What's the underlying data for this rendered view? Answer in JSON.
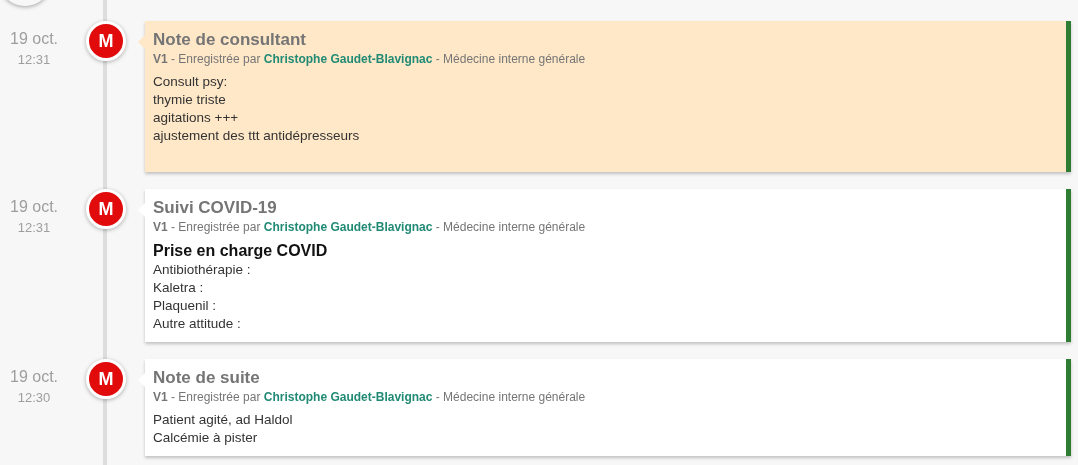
{
  "timeline": [
    {
      "date": "19 oct.",
      "time": "12:31",
      "marker": "M",
      "highlighted": true,
      "title": "Note de consultant",
      "version": "V1",
      "recorded_by": "- Enregistrée par",
      "author": "Christophe Gaudet-Blavignac",
      "service": "- Médecine interne générale",
      "body": [
        {
          "kind": "text",
          "text": "Consult psy:"
        },
        {
          "kind": "text",
          "text": "thymie triste"
        },
        {
          "kind": "text",
          "text": "agitations +++"
        },
        {
          "kind": "text",
          "text": "ajustement des ttt antidépresseurs"
        }
      ]
    },
    {
      "date": "19 oct.",
      "time": "12:31",
      "marker": "M",
      "highlighted": false,
      "title": "Suivi COVID-19",
      "version": "V1",
      "recorded_by": "- Enregistrée par",
      "author": "Christophe Gaudet-Blavignac",
      "service": "- Médecine interne générale",
      "body": [
        {
          "kind": "heading",
          "text": "Prise en charge COVID"
        },
        {
          "kind": "text",
          "text": "Antibiothérapie :"
        },
        {
          "kind": "text",
          "text": "Kaletra :"
        },
        {
          "kind": "text",
          "text": "Plaquenil :"
        },
        {
          "kind": "text",
          "text": "Autre attitude :"
        }
      ]
    },
    {
      "date": "19 oct.",
      "time": "12:30",
      "marker": "M",
      "highlighted": false,
      "title": "Note de suite",
      "version": "V1",
      "recorded_by": "- Enregistrée par",
      "author": "Christophe Gaudet-Blavignac",
      "service": "- Médecine interne générale",
      "body": [
        {
          "kind": "text",
          "text": "Patient agité, ad Haldol"
        },
        {
          "kind": "text",
          "text": "Calcémie à pister"
        }
      ]
    }
  ]
}
